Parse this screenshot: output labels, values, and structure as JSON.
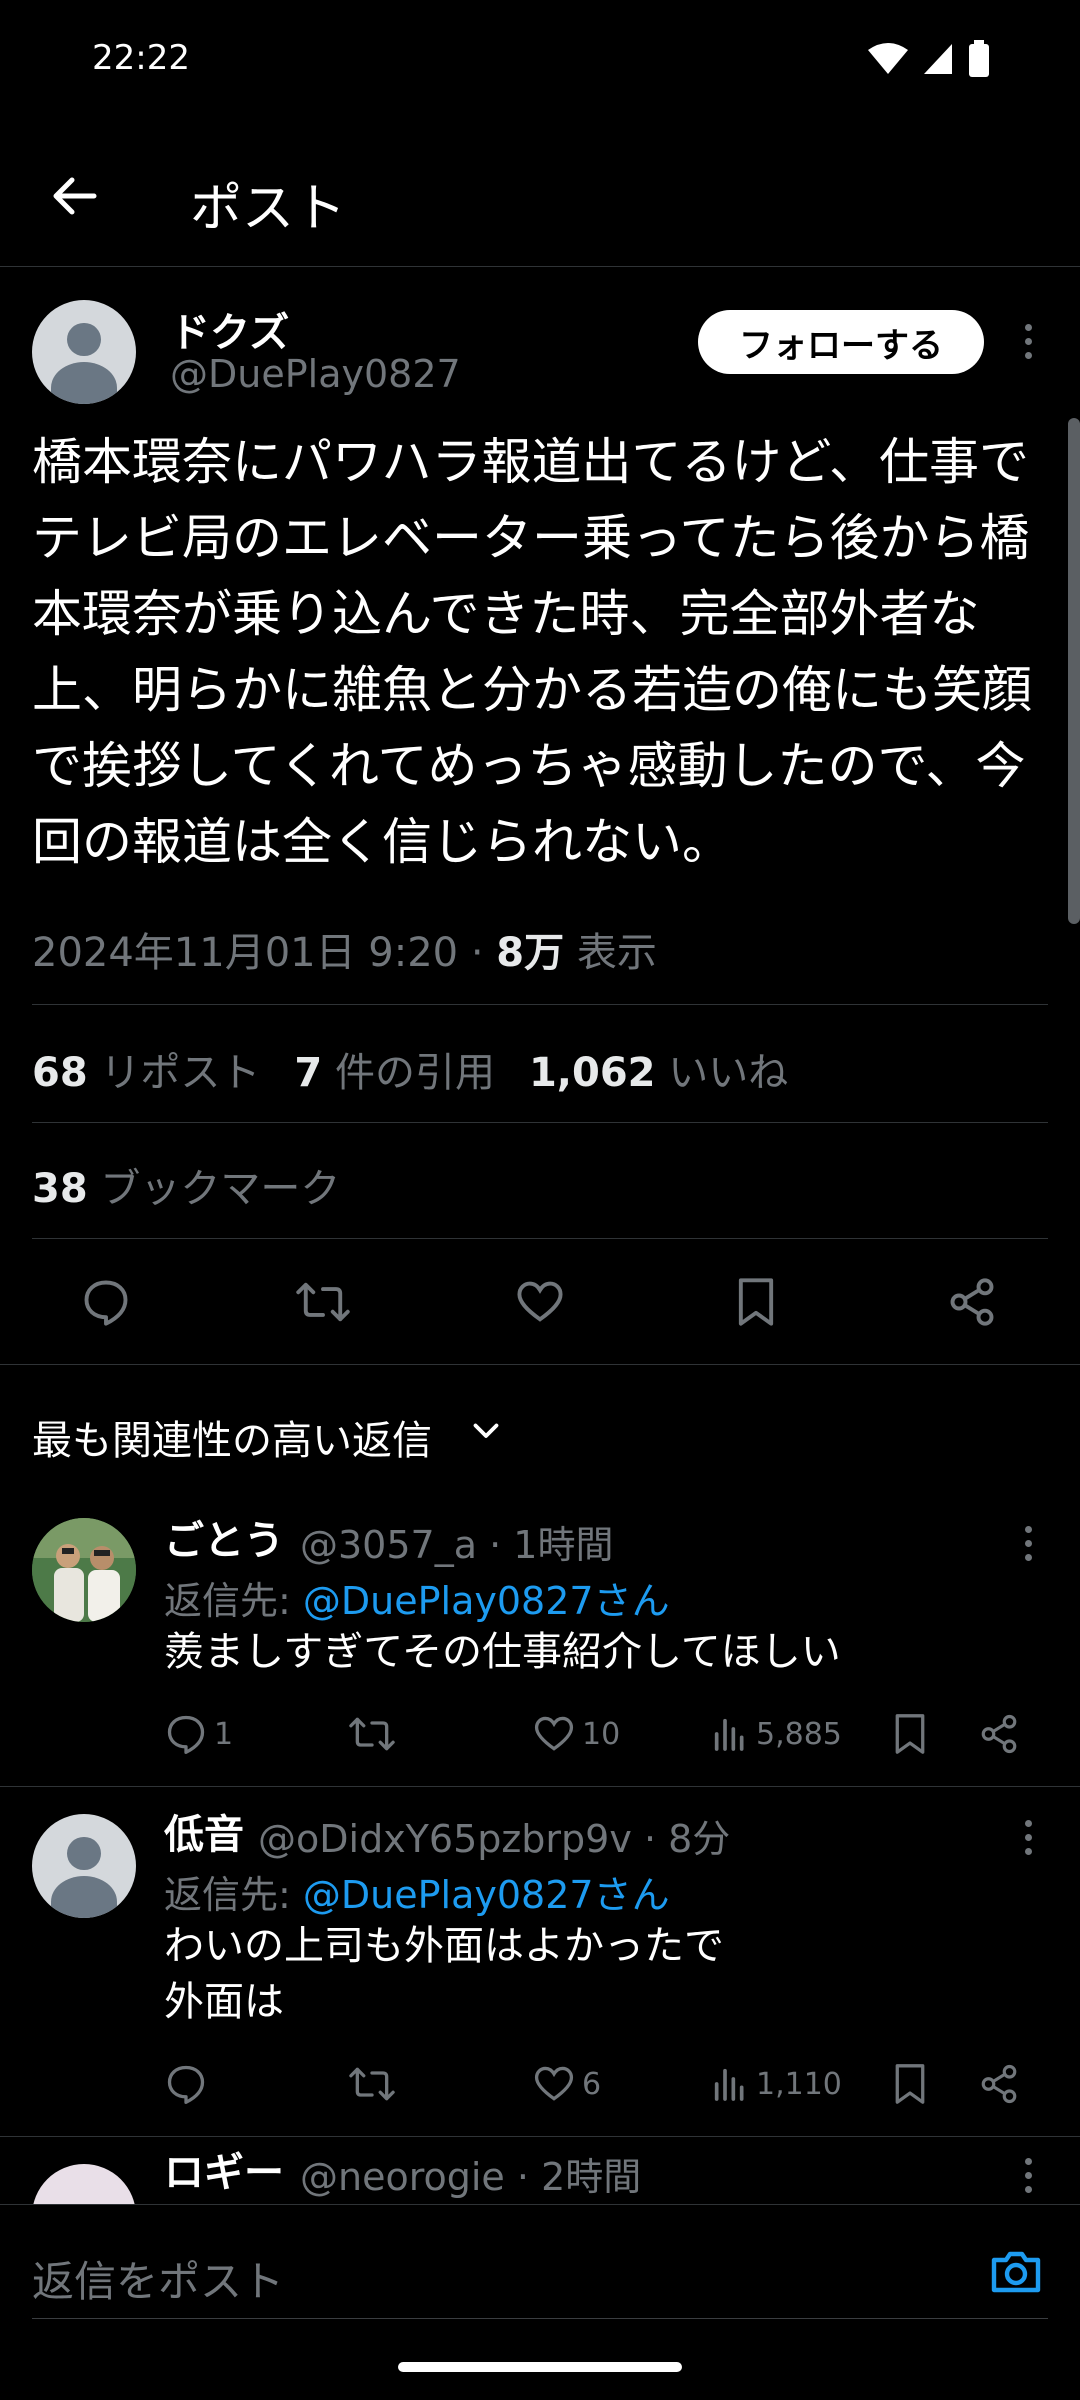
{
  "status_bar": {
    "time": "22:22"
  },
  "header": {
    "title": "ポスト"
  },
  "post": {
    "author_name": "ドクズ",
    "author_handle": "@DuePlay0827",
    "follow_label": "フォローする",
    "text": "橋本環奈にパワハラ報道出てるけど、仕事で\nテレビ局のエレベーター乗ってたら後から橋\n本環奈が乗り込んできた時、完全部外者な\n上、明らかに雑魚と分かる若造の俺にも笑顔\nで挨拶してくれてめっちゃ感動したので、今\n回の報道は全く信じられない。",
    "datetime": "2024年11月01日 9:20",
    "sep": "·",
    "views_count": "8万",
    "views_label": "表示",
    "reposts_count": "68",
    "reposts_label": "リポスト",
    "quotes_count": "7",
    "quotes_label": "件の引用",
    "likes_count": "1,062",
    "likes_label": "いいね",
    "bookmarks_count": "38",
    "bookmarks_label": "ブックマーク"
  },
  "sort": {
    "label": "最も関連性の高い返信"
  },
  "replies": [
    {
      "name": "ごとう",
      "handle": "@3057_a",
      "sep": "·",
      "time": "1時間",
      "reply_to_prefix": "返信先:",
      "reply_to": "@DuePlay0827さん",
      "text": "羨ましすぎてその仕事紹介してほしい",
      "comments": "1",
      "reposts": "",
      "likes": "10",
      "views": "5,885"
    },
    {
      "name": "低音",
      "handle": "@oDidxY65pzbrp9v",
      "sep": "·",
      "time": "8分",
      "reply_to_prefix": "返信先:",
      "reply_to": "@DuePlay0827さん",
      "text": "わいの上司も外面はよかったで\n外面は",
      "comments": "",
      "reposts": "",
      "likes": "6",
      "views": "1,110"
    },
    {
      "name": "ロギー",
      "handle": "@neorogie",
      "sep": "·",
      "time": "2時間"
    }
  ],
  "compose": {
    "placeholder": "返信をポスト"
  },
  "colors": {
    "accent": "#1d9bf0",
    "background": "#000000",
    "muted": "#71767b"
  }
}
